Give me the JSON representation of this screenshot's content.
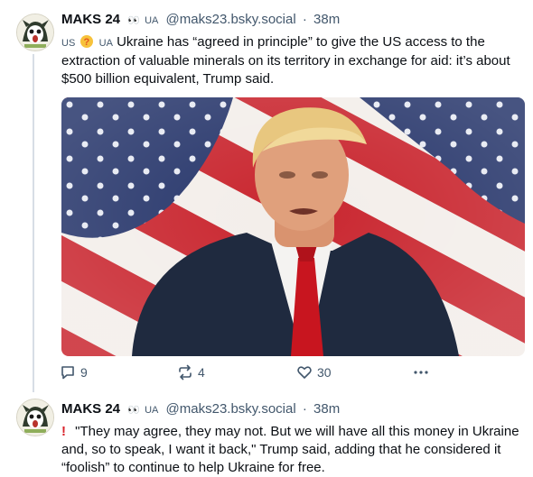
{
  "posts": [
    {
      "author": "MAKS 24",
      "eyes": "👀",
      "flag": "UA",
      "handle": "@maks23.bsky.social",
      "separator": "·",
      "time": "38m",
      "prefix_flag_1": "US",
      "prefix_flag_2": "UA",
      "text": "Ukraine has “agreed in principle” to give the US access to the extraction of valuable minerals on its territory in exchange for aid: it’s about $500 billion equivalent, Trump said.",
      "actions": {
        "replies": "9",
        "reposts": "4",
        "likes": "30"
      }
    },
    {
      "author": "MAKS 24",
      "eyes": "👀",
      "flag": "UA",
      "handle": "@maks23.bsky.social",
      "separator": "·",
      "time": "38m",
      "marker": "!",
      "text": "\"They may agree, they may not. But we will have all this money in Ukraine and, so to speak, I want it back,\" Trump said, adding that he considered it “foolish” to continue to help Ukraine for free."
    }
  ],
  "colors": {
    "text": "#0b0f14",
    "muted": "#42576c",
    "accent": "#1083fe",
    "thread_line": "#d7dde5"
  },
  "icons": [
    "reply-icon",
    "repost-icon",
    "like-icon",
    "more-icon"
  ]
}
